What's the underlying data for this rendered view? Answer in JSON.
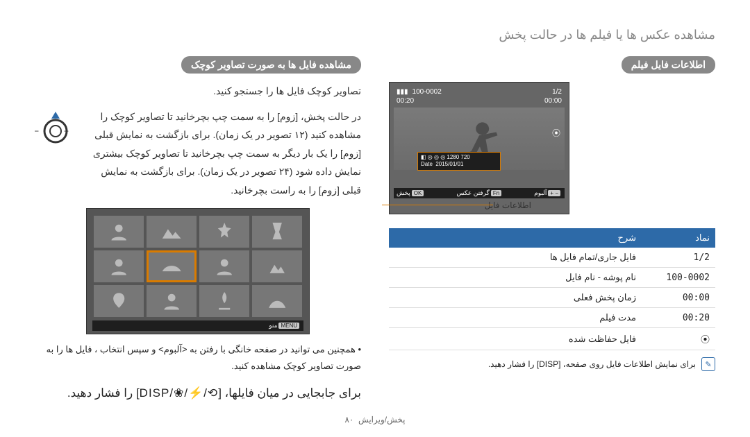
{
  "top_title": "مشاهده عکس ها یا فیلم ها در حالت پخش",
  "right": {
    "section": "اطلاعات فایل فیلم",
    "lcd": {
      "top_left_counter": "1/2",
      "top_right_clip": "100-0002",
      "elapsed": "00:00",
      "duration": "00:20",
      "protect": "⦿",
      "info_box": {
        "icons_row": "◧ ◎ ◎ ◎   1280 720",
        "date_label": "Date",
        "date": "2015/01/01"
      },
      "bottom": {
        "album_btn": "− +",
        "album_label": "آلبوم",
        "ok_btn": "OK",
        "play_label": "پخش",
        "capture_label": "گرفتن عکس",
        "capture_btn": "Fn"
      }
    },
    "info_pointer": "اطلاعات فایل",
    "table": {
      "head_sym": "نماد",
      "head_desc": "شرح",
      "rows": [
        {
          "sym": "1/2",
          "desc": "فایل جاری/تمام فایل ها"
        },
        {
          "sym": "100-0002",
          "desc": "نام پوشه - نام فایل"
        },
        {
          "sym": "00:00",
          "desc": "زمان پخش فعلی"
        },
        {
          "sym": "00:20",
          "desc": "مدت فیلم"
        },
        {
          "sym": "⦿",
          "desc": "فایل حفاظت شده"
        }
      ]
    },
    "note": "برای نمایش اطلاعات فایل روی صفحه، [DISP] را فشار دهید."
  },
  "left": {
    "section": "مشاهده فایل ها به صورت تصاویر کوچک",
    "intro": "تصاویر کوچک فایل ها را جستجو کنید.",
    "tip": "در حالت پخش، [زوم] را به سمت چپ بچرخانید تا تصاویر کوچک را مشاهده کنید (۱۲ تصویر در یک زمان). برای بازگشت به نمایش قبلی [زوم] را یک بار دیگر به سمت چپ بچرخانید تا تصاویر کوچک بیشتری نمایش داده شود (۲۴ تصویر در یک زمان). برای بازگشت به نمایش قبلی [زوم] را به راست بچرخانید.",
    "thumbs_bar": {
      "menu_chip": "MENU",
      "menu_label": "منو"
    },
    "bullet": "همچنین می توانید در صفحه خانگی با رفتن به <آلبوم> و سپس انتخاب ، فایل ها را به صورت تصاویر کوچک مشاهده کنید.",
    "big": {
      "pre": "برای جابجایی در میان فایلها، [",
      "keys": "DISP/❀/⚡/⟲",
      "post": "] را فشار دهید."
    }
  },
  "footer": {
    "section": "پخش/ویرایش",
    "page": "۸۰"
  }
}
